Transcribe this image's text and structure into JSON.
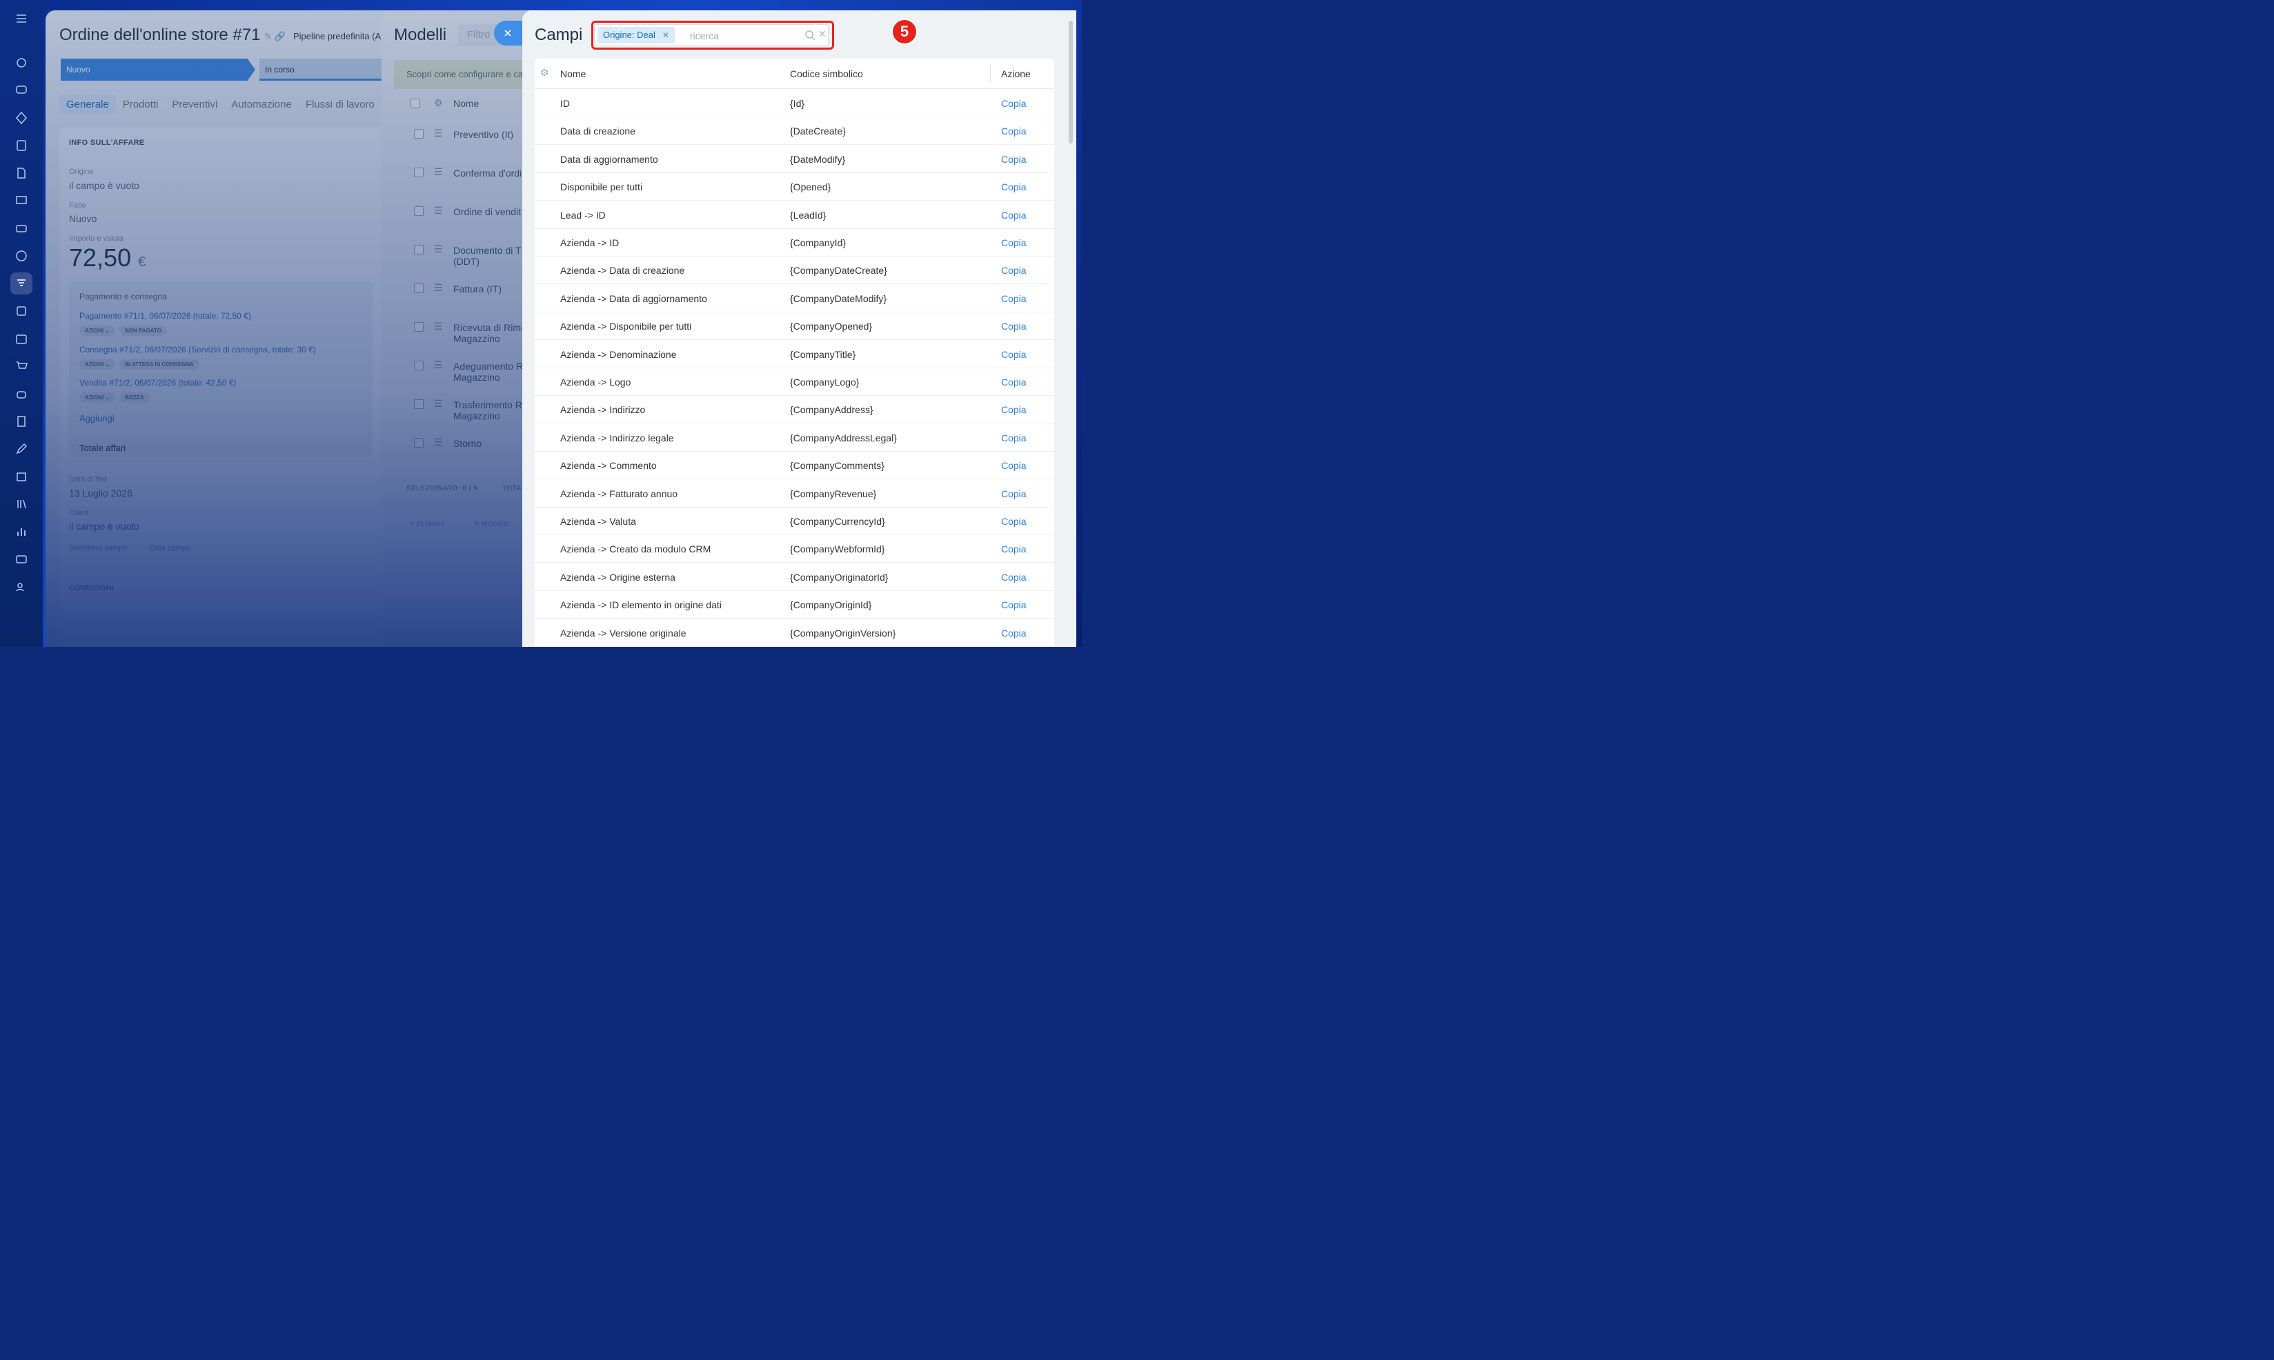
{
  "rail": {
    "icons": [
      "menu-icon",
      "refresh-icon",
      "chat-icon",
      "target-icon",
      "news-icon",
      "document-icon",
      "presentation-icon",
      "card-icon",
      "hexagon-icon",
      "crm-icon",
      "task-icon",
      "calendar-icon",
      "cart-icon",
      "robot-icon",
      "sign-icon",
      "pen-icon",
      "building-icon",
      "library-icon",
      "analytics-icon",
      "mail-icon",
      "group-icon"
    ]
  },
  "deal": {
    "title": "Ordine dell'online store #71",
    "pipeline": "Pipeline predefinita (A",
    "stages": [
      "Nuovo",
      "In corso"
    ],
    "tabs": [
      "Generale",
      "Prodotti",
      "Preventivi",
      "Automazione",
      "Flussi di lavoro"
    ],
    "section_title": "INFO SULL'AFFARE",
    "origin_label": "Origine",
    "origin_value": "il campo è vuoto",
    "phase_label": "Fase",
    "phase_value": "Nuovo",
    "amount_label": "Importo e valuta",
    "amount": "72,50",
    "currency": "€",
    "payment_title": "Pagamento e consegna",
    "payment_link": "Pagamento #71/1, 06/07/2026 (totale: 72,50 €)",
    "payment_badges": [
      "AZIONI ⌄",
      "NON PAGATO"
    ],
    "delivery_link": "Consegna #71/2, 06/07/2026 (Servizio di consegna, totale: 30 €)",
    "delivery_badges": [
      "AZIONI ⌄",
      "IN ATTESA DI CONSEGNA"
    ],
    "sale_link": "Vendita #71/2, 06/07/2026 (totale: 42,50 €)",
    "sale_badges": [
      "AZIONI ⌄",
      "BOZZA"
    ],
    "add_label": "Aggiungi",
    "total_label": "Totale affari",
    "end_date_label": "Data di fine",
    "end_date_value": "13 Luglio 2026",
    "client_label": "Client",
    "client_value": "il campo è vuoto",
    "select_field": "Seleziona campo",
    "create_field": "Crea campo",
    "conditions": "CONDIZIONI"
  },
  "models": {
    "title": "Modelli",
    "filter_placeholder": "Filtro",
    "hint": "Scopri come configurare e ca",
    "col_name": "Nome",
    "rows": [
      "Preventivo (It)",
      "Conferma d'ordi",
      "Ordine di vendit",
      "Documento di T\n(DDT)",
      "Fattura (IT)",
      "Ricevuta di Rima\nMagazzino",
      "Adeguamento R\nMagazzino",
      "Trasferimento R\nMagazzino",
      "Storno"
    ],
    "selected": "SELEZIONATO: 0 / 9",
    "total": "TOTA",
    "delete": "ELIMINA",
    "modify": "MODIFIC"
  },
  "fields": {
    "title": "Campi",
    "filter_tag": "Origine: Deal",
    "search_placeholder": "ricerca",
    "step_number": "5",
    "col_name": "Nome",
    "col_code": "Codice simbolico",
    "col_action": "Azione",
    "rows": [
      {
        "name": "ID",
        "code": "{Id}",
        "action": "Copia"
      },
      {
        "name": "Data di creazione",
        "code": "{DateCreate}",
        "action": "Copia"
      },
      {
        "name": "Data di aggiornamento",
        "code": "{DateModify}",
        "action": "Copia"
      },
      {
        "name": "Disponibile per tutti",
        "code": "{Opened}",
        "action": "Copia"
      },
      {
        "name": "Lead -> ID",
        "code": "{LeadId}",
        "action": "Copia"
      },
      {
        "name": "Azienda -> ID",
        "code": "{CompanyId}",
        "action": "Copia"
      },
      {
        "name": "Azienda -> Data di creazione",
        "code": "{CompanyDateCreate}",
        "action": "Copia"
      },
      {
        "name": "Azienda -> Data di aggiornamento",
        "code": "{CompanyDateModify}",
        "action": "Copia"
      },
      {
        "name": "Azienda -> Disponibile per tutti",
        "code": "{CompanyOpened}",
        "action": "Copia"
      },
      {
        "name": "Azienda -> Denominazione",
        "code": "{CompanyTitle}",
        "action": "Copia"
      },
      {
        "name": "Azienda -> Logo",
        "code": "{CompanyLogo}",
        "action": "Copia"
      },
      {
        "name": "Azienda -> Indirizzo",
        "code": "{CompanyAddress}",
        "action": "Copia"
      },
      {
        "name": "Azienda -> Indirizzo legale",
        "code": "{CompanyAddressLegal}",
        "action": "Copia"
      },
      {
        "name": "Azienda -> Commento",
        "code": "{CompanyComments}",
        "action": "Copia"
      },
      {
        "name": "Azienda -> Fatturato annuo",
        "code": "{CompanyRevenue}",
        "action": "Copia"
      },
      {
        "name": "Azienda -> Valuta",
        "code": "{CompanyCurrencyId}",
        "action": "Copia"
      },
      {
        "name": "Azienda -> Creato da modulo CRM",
        "code": "{CompanyWebformId}",
        "action": "Copia"
      },
      {
        "name": "Azienda -> Origine esterna",
        "code": "{CompanyOriginatorId}",
        "action": "Copia"
      },
      {
        "name": "Azienda -> ID elemento in origine dati",
        "code": "{CompanyOriginId}",
        "action": "Copia"
      },
      {
        "name": "Azienda -> Versione originale",
        "code": "{CompanyOriginVersion}",
        "action": "Copia"
      }
    ]
  },
  "colors": {
    "accent": "#2f7fd6",
    "highlight": "#e5231b",
    "stage_active": "#3a86dc"
  }
}
